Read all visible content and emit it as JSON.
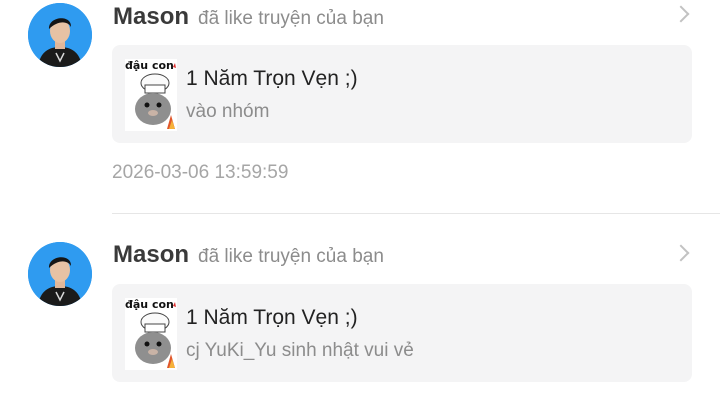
{
  "notifications": [
    {
      "user": "Mason",
      "action": "đã like truyện của bạn",
      "avatar_icon": "person-avatar",
      "story": {
        "cover_label": "đậu con",
        "cover_icon": "chef-hamster-cover",
        "title": "1 Năm Trọn Vẹn ;)",
        "subtitle": "vào nhóm"
      },
      "timestamp": "2026-03-06 13:59:59"
    },
    {
      "user": "Mason",
      "action": "đã like truyện của bạn",
      "avatar_icon": "person-avatar",
      "story": {
        "cover_label": "đậu con",
        "cover_icon": "chef-hamster-cover",
        "title": "1 Năm Trọn Vẹn ;)",
        "subtitle": "cj YuKi_Yu sinh nhật vui vẻ"
      }
    }
  ],
  "colors": {
    "avatar_bg": "#2f9bf0",
    "card_bg": "#f4f4f5",
    "name": "#3a3a3a",
    "muted": "#8c8c8c"
  }
}
